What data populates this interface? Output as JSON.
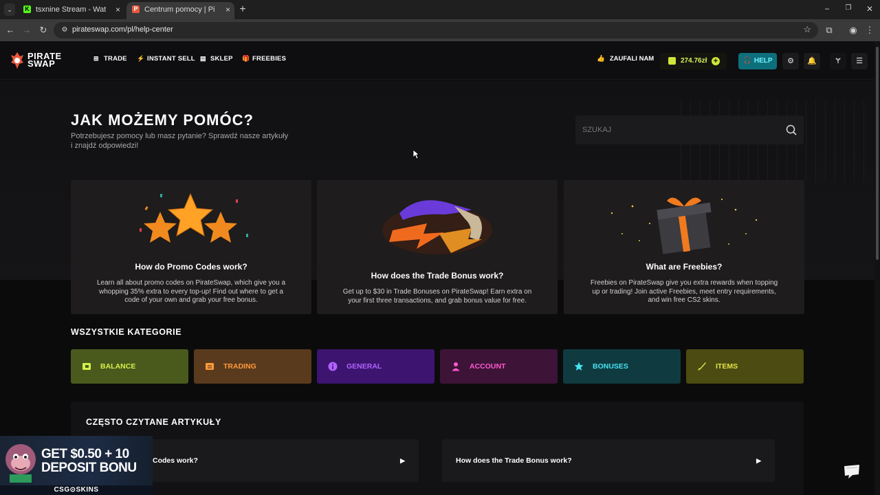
{
  "browser": {
    "tabs": [
      {
        "title": "tsxnine Stream - Watch Live on",
        "favicon": "K",
        "favicon_color": "#53fc18",
        "active": false
      },
      {
        "title": "Centrum pomocy | PirateSwap",
        "favicon": "P",
        "favicon_color": "#e8583b",
        "active": true
      }
    ],
    "tab_close": "×",
    "new_tab": "+",
    "url": "pirateswap.com/pl/help-center",
    "window_controls": {
      "minimize": "−",
      "restore": "❐",
      "close": "✕"
    }
  },
  "header": {
    "logo": {
      "line1": "PIRATE",
      "line2": "SWAP"
    },
    "nav": [
      {
        "label": "TRADE",
        "icon": "trade-icon",
        "glyph": "⊞"
      },
      {
        "label": "INSTANT SELL",
        "icon": "lightning-icon",
        "glyph": "⚡"
      },
      {
        "label": "SKLEP",
        "icon": "store-icon",
        "glyph": "▤"
      },
      {
        "label": "FREEBIES",
        "icon": "gift-icon",
        "glyph": "🎁"
      }
    ],
    "trusted": "ZAUFALI NAM",
    "balance": "274.76zł",
    "help": "HELP",
    "colors": {
      "accent_lime": "#cfe63a",
      "accent_cyan": "#0e6f7c"
    }
  },
  "hero": {
    "title": "JAK MOŻEMY POMÓC?",
    "subtitle": "Potrzebujesz pomocy lub masz pytanie? Sprawdź nasze artykuły i znajdź odpowiedzi!",
    "search_placeholder": "SZUKAJ"
  },
  "cards": [
    {
      "title": "How do Promo Codes work?",
      "desc": "Learn all about promo codes on PirateSwap, which give you a whopping 35% extra to every top-up! Find out where to get a code of your own and grab your free bonus.",
      "art": "stars"
    },
    {
      "title": "How does the Trade Bonus work?",
      "desc": "Get up to $30 in Trade Bonuses on PirateSwap! Earn extra on your first three transactions, and grab bonus value for free.",
      "art": "knife"
    },
    {
      "title": "What are Freebies?",
      "desc": "Freebies on PirateSwap give you extra rewards when topping up or trading! Join active Freebies, meet entry requirements, and win free CS2 skins.",
      "art": "gift"
    }
  ],
  "categories": {
    "heading": "WSZYSTKIE KATEGORIE",
    "items": [
      {
        "label": "BALANCE",
        "icon": "wallet-icon",
        "bg": "#4a5a1d",
        "fg": "#d6f04a"
      },
      {
        "label": "TRADING",
        "icon": "trade-icon",
        "bg": "#5a3a1c",
        "fg": "#ff9a3c"
      },
      {
        "label": "GENERAL",
        "icon": "info-icon",
        "bg": "#3d1470",
        "fg": "#b063ff"
      },
      {
        "label": "ACCOUNT",
        "icon": "user-icon",
        "bg": "#3d1437",
        "fg": "#ff5ad2"
      },
      {
        "label": "BONUSES",
        "icon": "star-icon",
        "bg": "#0f3b40",
        "fg": "#46e3f2"
      },
      {
        "label": "ITEMS",
        "icon": "knife-icon",
        "bg": "#4b4b12",
        "fg": "#e4e347"
      }
    ]
  },
  "articles": {
    "heading": "CZĘSTO CZYTANE ARTYKUŁY",
    "items": [
      {
        "label": "How do Promo Codes work?"
      },
      {
        "label": "How does the Trade Bonus work?"
      }
    ]
  },
  "ad": {
    "line1_a": "GET ",
    "line1_b": "$0.50 + 10",
    "line2": "DEPOSIT BONU",
    "brand": "CSG⊙SKINS"
  }
}
